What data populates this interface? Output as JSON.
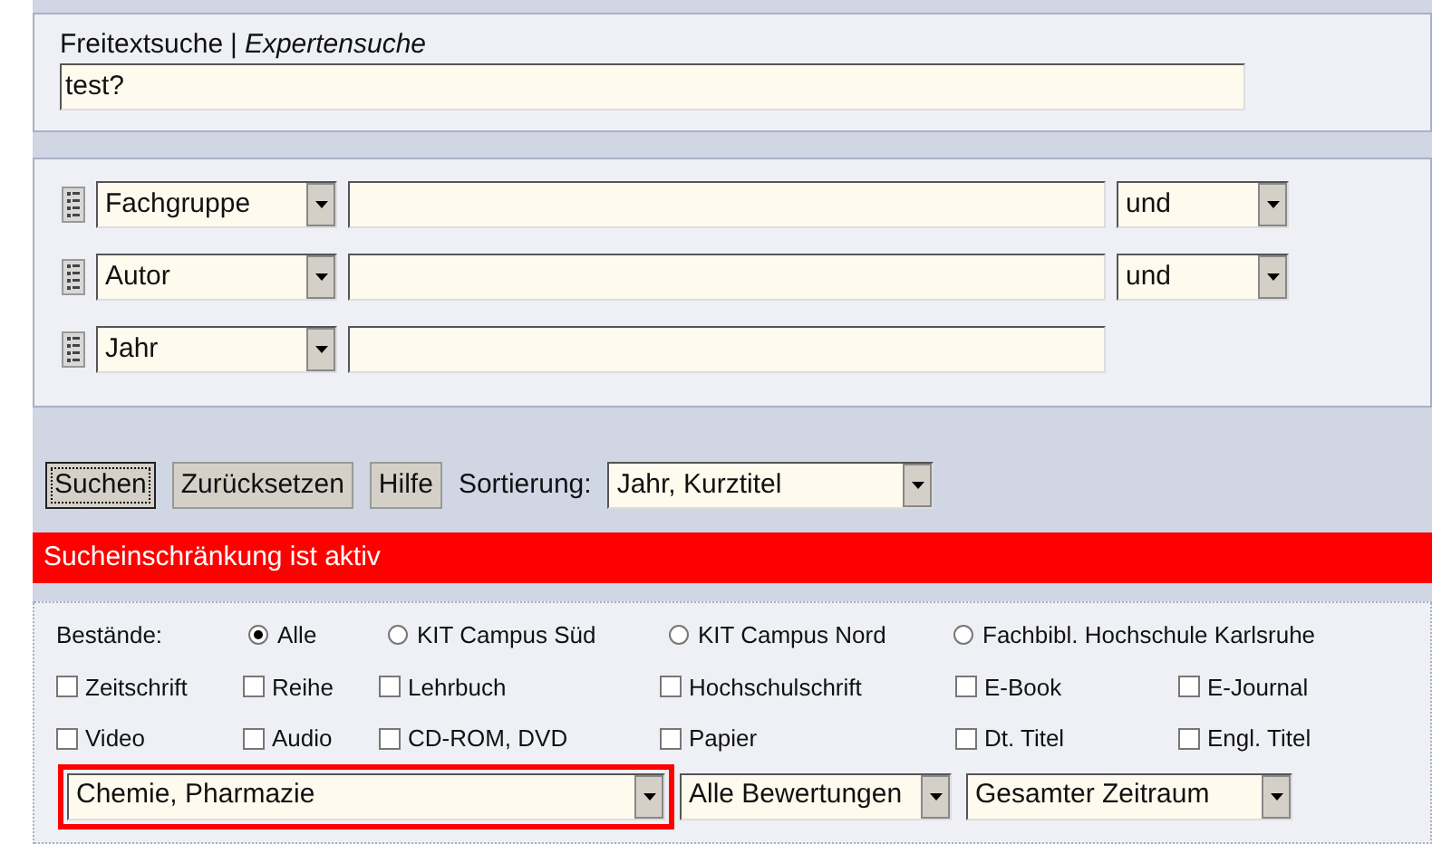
{
  "search_mode": {
    "freetext": "Freitextsuche",
    "separator": "|",
    "expert": "Expertensuche"
  },
  "query": {
    "value": "test?"
  },
  "fields": [
    {
      "field": "Fachgruppe",
      "operator": "und"
    },
    {
      "field": "Autor",
      "operator": "und"
    },
    {
      "field": "Jahr"
    }
  ],
  "buttons": [
    {
      "label": "Suchen",
      "focused": true
    },
    {
      "label": "Zurücksetzen",
      "focused": false
    },
    {
      "label": "Hilfe",
      "focused": false
    }
  ],
  "sort": {
    "label": "Sortierung:",
    "value": "Jahr, Kurztitel"
  },
  "restriction_banner": "Sucheinschränkung ist aktiv",
  "holdings": {
    "label": "Bestände:",
    "options": [
      {
        "label": "Alle",
        "selected": true
      },
      {
        "label": "KIT Campus Süd",
        "selected": false
      },
      {
        "label": "KIT Campus Nord",
        "selected": false
      },
      {
        "label": "Fachbibl. Hochschule Karlsruhe",
        "selected": false
      }
    ]
  },
  "media_types": [
    [
      {
        "label": "Zeitschrift",
        "checked": false
      },
      {
        "label": "Reihe",
        "checked": false
      },
      {
        "label": "Lehrbuch",
        "checked": false
      },
      {
        "label": "Hochschulschrift",
        "checked": false
      },
      {
        "label": "E-Book",
        "checked": false
      },
      {
        "label": "E-Journal",
        "checked": false
      }
    ],
    [
      {
        "label": "Video",
        "checked": false
      },
      {
        "label": "Audio",
        "checked": false
      },
      {
        "label": "CD-ROM, DVD",
        "checked": false
      },
      {
        "label": "Papier",
        "checked": false
      },
      {
        "label": "Dt. Titel",
        "checked": false
      },
      {
        "label": "Engl. Titel",
        "checked": false
      }
    ]
  ],
  "filters": [
    {
      "value": "Chemie, Pharmazie",
      "highlighted": true
    },
    {
      "value": "Alle Bewertungen"
    },
    {
      "value": "Gesamter Zeitraum"
    }
  ]
}
